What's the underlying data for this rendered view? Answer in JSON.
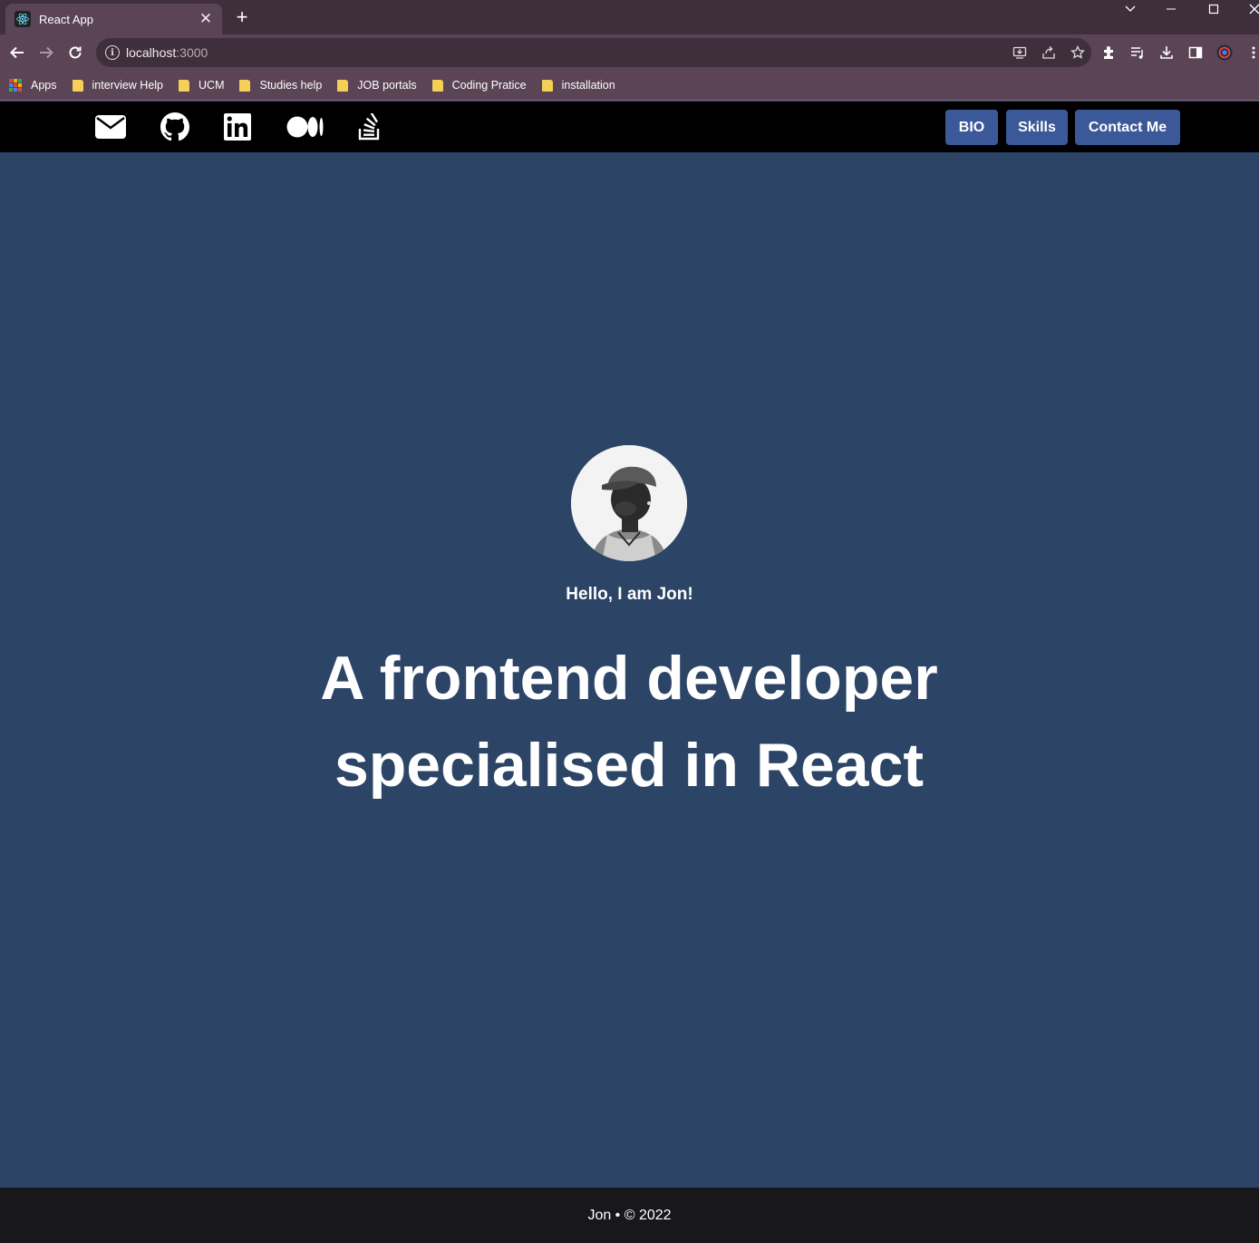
{
  "browser": {
    "tab_title": "React App",
    "tab_close": "✕",
    "new_tab": "+",
    "url_host": "localhost",
    "url_port": ":3000",
    "bookmarks": [
      {
        "label": "Apps",
        "icon": "apps-grid-icon"
      },
      {
        "label": "interview Help",
        "icon": "folder-icon"
      },
      {
        "label": "UCM",
        "icon": "folder-icon"
      },
      {
        "label": "Studies help",
        "icon": "folder-icon"
      },
      {
        "label": "JOB portals",
        "icon": "folder-icon"
      },
      {
        "label": "Coding Pratice",
        "icon": "folder-icon"
      },
      {
        "label": "installation",
        "icon": "folder-icon"
      }
    ]
  },
  "header": {
    "social_icons": [
      "envelope-icon",
      "github-icon",
      "linkedin-icon",
      "medium-icon",
      "stackoverflow-icon"
    ],
    "nav": {
      "bio": "BIO",
      "skills": "Skills",
      "contact": "Contact Me"
    }
  },
  "hero": {
    "greeting": "Hello, I am Jon!",
    "headline": "A frontend developer specialised in React"
  },
  "footer": {
    "text": "Jon • © 2022"
  },
  "colors": {
    "hero_bg": "#2c4466",
    "header_bg": "#000000",
    "nav_button_bg": "#3b5998",
    "footer_bg": "#18181b",
    "chrome_bg": "#5a4455"
  }
}
